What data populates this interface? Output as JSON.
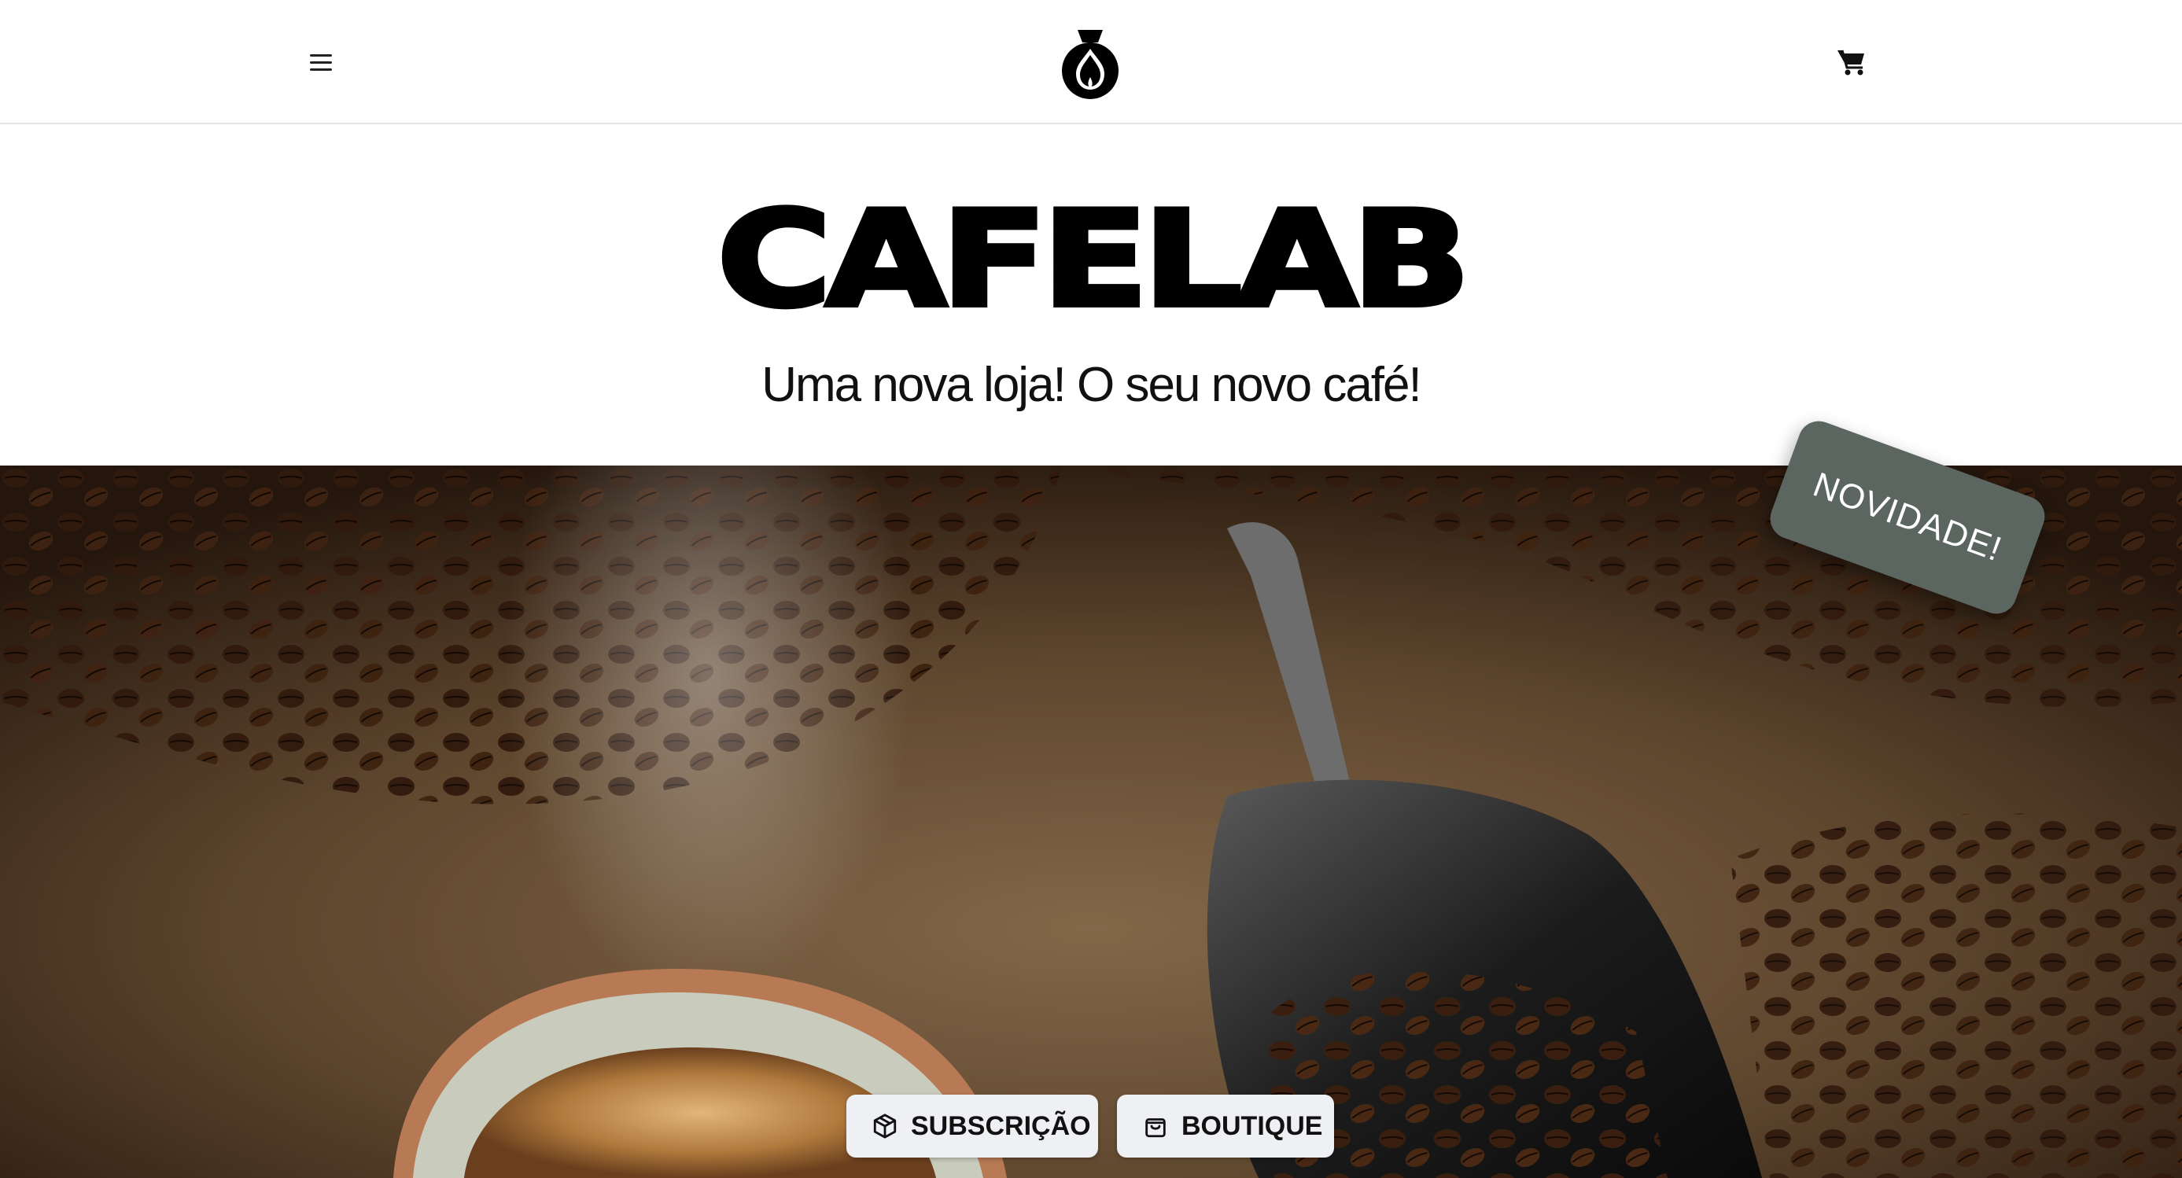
{
  "header": {
    "menu_icon": "hamburger-menu-icon",
    "logo_icon": "cafelab-logo-icon",
    "cart_icon": "shopping-cart-icon"
  },
  "hero": {
    "brand": "CAFELAB",
    "tagline": "Uma nova loja! O seu novo café!",
    "badge": "NOVIDADE!",
    "badge_color": "#5b6660"
  },
  "actions": {
    "subscription_label": "SUBSCRIÇÃO",
    "subscription_icon": "package-box-icon",
    "boutique_label": "BOUTIQUE",
    "boutique_icon": "shopping-bag-icon",
    "button_color": "#eef0f4"
  }
}
